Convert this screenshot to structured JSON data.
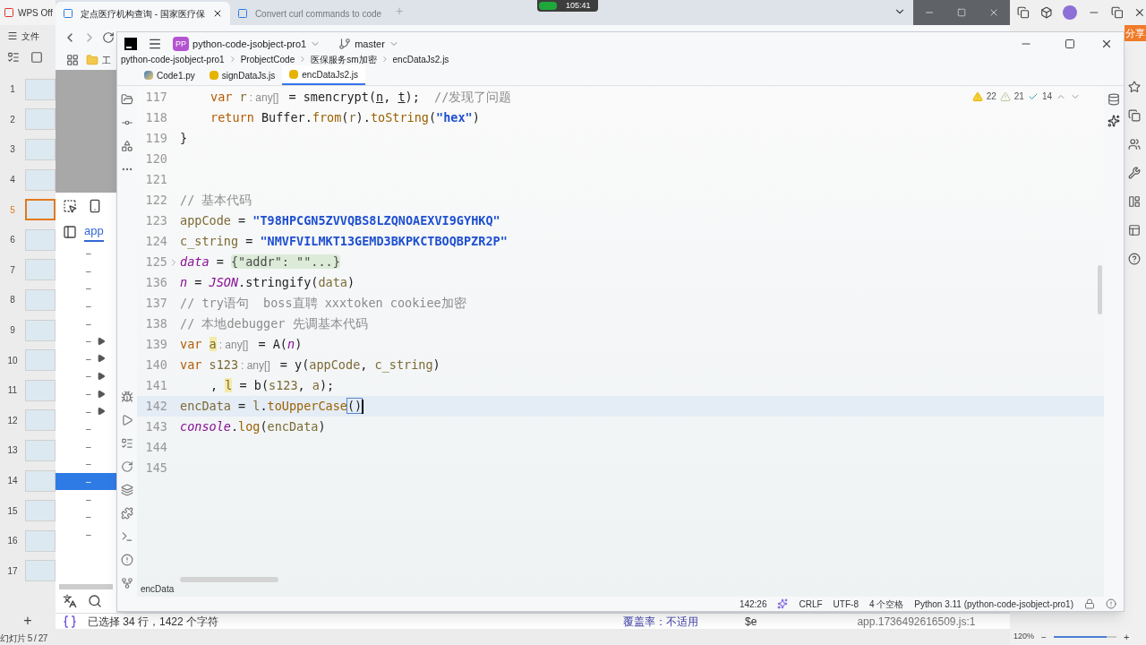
{
  "wps": {
    "tab": "WPS Off",
    "menu": "文件",
    "slides": [
      {
        "number": "1",
        "selected": false
      },
      {
        "number": "2",
        "selected": false
      },
      {
        "number": "3",
        "selected": false
      },
      {
        "number": "4",
        "selected": false
      },
      {
        "number": "5",
        "selected": true
      },
      {
        "number": "6",
        "selected": false
      },
      {
        "number": "7",
        "selected": false
      },
      {
        "number": "8",
        "selected": false
      },
      {
        "number": "9",
        "selected": false
      },
      {
        "number": "10",
        "selected": false
      },
      {
        "number": "11",
        "selected": false
      },
      {
        "number": "12",
        "selected": false
      },
      {
        "number": "13",
        "selected": false
      },
      {
        "number": "14",
        "selected": false
      },
      {
        "number": "15",
        "selected": false
      },
      {
        "number": "16",
        "selected": false
      },
      {
        "number": "17",
        "selected": false
      }
    ],
    "add": "+",
    "status": "幻灯片 5 / 27",
    "share": "分享",
    "zoom": "120%",
    "zoom_out": "−",
    "zoom_in": "+",
    "zoom_slider": {
      "level": 0.85
    }
  },
  "recorder": {
    "time": "105:41"
  },
  "browser": {
    "tabs": [
      {
        "title": "定点医疗机构查询 - 国家医疗保",
        "selected": true
      },
      {
        "title": "Convert curl commands to code",
        "selected": false
      }
    ],
    "new_tab": "+",
    "bookmark": "工",
    "devtools": {
      "tab": {
        "label": "app",
        "selected": true
      },
      "rows": [
        {
          "text": "–",
          "expandable": false,
          "selected": false
        },
        {
          "text": "–",
          "expandable": false,
          "selected": false
        },
        {
          "text": "–",
          "expandable": false,
          "selected": false
        },
        {
          "text": "–",
          "expandable": false,
          "selected": false
        },
        {
          "text": "–",
          "expandable": false,
          "selected": false
        },
        {
          "text": "–",
          "expandable": true,
          "selected": false
        },
        {
          "text": "–",
          "expandable": true,
          "selected": false
        },
        {
          "text": "–",
          "expandable": true,
          "selected": false
        },
        {
          "text": "–",
          "expandable": true,
          "selected": false
        },
        {
          "text": "–",
          "expandable": true,
          "selected": false
        },
        {
          "text": "–",
          "expandable": false,
          "selected": false
        },
        {
          "text": "–",
          "expandable": false,
          "selected": false
        },
        {
          "text": "–",
          "expandable": false,
          "selected": false
        },
        {
          "text": "–",
          "expandable": false,
          "selected": true
        },
        {
          "text": "–",
          "expandable": false,
          "selected": false
        },
        {
          "text": "–",
          "expandable": false,
          "selected": false
        },
        {
          "text": "–",
          "expandable": false,
          "selected": false
        }
      ],
      "selection": "已选择 34 行，1422 个字符",
      "coverage": "覆盖率：不适用",
      "variable": "$e",
      "source": "app.1736492616509.js:1"
    }
  },
  "ide": {
    "project_badge": "PP",
    "project": "python-code-jsobject-pro1",
    "branch": "master",
    "breadcrumbs": [
      "python-code-jsobject-pro1",
      "ProbjectCode",
      "医保服务sm加密",
      "encDataJs2.js"
    ],
    "tabs": [
      {
        "label": "Code1.py",
        "kind": "py",
        "selected": false
      },
      {
        "label": "signDataJs.js",
        "kind": "js",
        "selected": false
      },
      {
        "label": "encDataJs2.js",
        "kind": "js",
        "selected": true
      }
    ],
    "inspections": {
      "warnings": "22",
      "weak_warnings": "21",
      "typos": "14"
    },
    "lines": [
      {
        "number": "117",
        "indented": true,
        "foldable": false,
        "current": false,
        "tokens": [
          {
            "kind": "kw",
            "text": "var "
          },
          {
            "kind": "local",
            "text": "r"
          },
          {
            "kind": "hint",
            "text": ": any[]"
          },
          {
            "kind": "plain",
            "text": " = smencrypt("
          },
          {
            "kind": "param",
            "text": "n"
          },
          {
            "kind": "plain",
            "text": ", "
          },
          {
            "kind": "param",
            "text": "t"
          },
          {
            "kind": "plain",
            "text": ");  "
          },
          {
            "kind": "cmt",
            "text": "//发现了问题"
          }
        ]
      },
      {
        "number": "118",
        "indented": true,
        "foldable": false,
        "current": false,
        "tokens": [
          {
            "kind": "kw",
            "text": "return "
          },
          {
            "kind": "plain",
            "text": "Buffer."
          },
          {
            "kind": "fn",
            "text": "from"
          },
          {
            "kind": "plain",
            "text": "("
          },
          {
            "kind": "local",
            "text": "r"
          },
          {
            "kind": "plain",
            "text": ")."
          },
          {
            "kind": "fn",
            "text": "toString"
          },
          {
            "kind": "plain",
            "text": "("
          },
          {
            "kind": "str",
            "text": "\"hex\""
          },
          {
            "kind": "plain",
            "text": ")"
          }
        ]
      },
      {
        "number": "119",
        "indented": false,
        "foldable": false,
        "current": false,
        "tokens": [
          {
            "kind": "plain",
            "text": "}"
          }
        ]
      },
      {
        "number": "120",
        "foldable": false,
        "current": false
      },
      {
        "number": "121",
        "foldable": false,
        "current": false
      },
      {
        "number": "122",
        "indented": false,
        "foldable": false,
        "current": false,
        "tokens": [
          {
            "kind": "cmt",
            "text": "// 基本代码"
          }
        ]
      },
      {
        "number": "123",
        "indented": false,
        "foldable": false,
        "current": false,
        "tokens": [
          {
            "kind": "local",
            "text": "appCode"
          },
          {
            "kind": "plain",
            "text": " = "
          },
          {
            "kind": "str",
            "text": "\"T98HPCGN5ZVVQBS8LZQNOAEXVI9GYHKQ\""
          }
        ]
      },
      {
        "number": "124",
        "indented": false,
        "foldable": false,
        "current": false,
        "tokens": [
          {
            "kind": "local",
            "text": "c_string"
          },
          {
            "kind": "plain",
            "text": " = "
          },
          {
            "kind": "str",
            "text": "\"NMVFVILMKT13GEMD3BKPKCTBOQBPZR2P\""
          }
        ]
      },
      {
        "number": "125",
        "indented": false,
        "foldable": true,
        "current": false,
        "tokens": [
          {
            "kind": "global",
            "text": "data"
          },
          {
            "kind": "plain",
            "text": " = "
          },
          {
            "kind": "fold",
            "text": "{\"addr\": \"\"...}"
          }
        ]
      },
      {
        "number": "136",
        "indented": false,
        "foldable": false,
        "current": false,
        "tokens": [
          {
            "kind": "global",
            "text": "n"
          },
          {
            "kind": "plain",
            "text": " = "
          },
          {
            "kind": "global",
            "text": "JSON"
          },
          {
            "kind": "plain",
            "text": ".stringify("
          },
          {
            "kind": "local",
            "text": "data"
          },
          {
            "kind": "plain",
            "text": ")"
          }
        ]
      },
      {
        "number": "137",
        "indented": false,
        "foldable": false,
        "current": false,
        "tokens": [
          {
            "kind": "cmt",
            "text": "// try语句  boss直聘 xxxtoken cookiee加密"
          }
        ]
      },
      {
        "number": "138",
        "indented": false,
        "foldable": false,
        "current": false,
        "tokens": [
          {
            "kind": "cmt",
            "text": "// 本地debugger 先调基本代码"
          }
        ]
      },
      {
        "number": "139",
        "indented": false,
        "foldable": false,
        "current": false,
        "tokens": [
          {
            "kind": "kw",
            "text": "var "
          },
          {
            "kind": "mark",
            "text": "a"
          },
          {
            "kind": "hint",
            "text": ": any[]"
          },
          {
            "kind": "plain",
            "text": " = A("
          },
          {
            "kind": "global",
            "text": "n"
          },
          {
            "kind": "plain",
            "text": ")"
          }
        ]
      },
      {
        "number": "140",
        "indented": false,
        "foldable": false,
        "current": false,
        "tokens": [
          {
            "kind": "kw",
            "text": "var "
          },
          {
            "kind": "local",
            "text": "s123"
          },
          {
            "kind": "hint",
            "text": ": any[]"
          },
          {
            "kind": "plain",
            "text": " = y("
          },
          {
            "kind": "local",
            "text": "appCode"
          },
          {
            "kind": "plain",
            "text": ", "
          },
          {
            "kind": "local",
            "text": "c_string"
          },
          {
            "kind": "plain",
            "text": ")"
          }
        ]
      },
      {
        "number": "141",
        "indented": true,
        "foldable": false,
        "current": false,
        "tokens": [
          {
            "kind": "plain",
            "text": ", "
          },
          {
            "kind": "mark",
            "text": "l"
          },
          {
            "kind": "plain",
            "text": " = b("
          },
          {
            "kind": "local",
            "text": "s123"
          },
          {
            "kind": "plain",
            "text": ", "
          },
          {
            "kind": "local",
            "text": "a"
          },
          {
            "kind": "plain",
            "text": ");"
          }
        ]
      },
      {
        "number": "142",
        "indented": false,
        "foldable": false,
        "current": true,
        "tokens": [
          {
            "kind": "local",
            "text": "encData"
          },
          {
            "kind": "plain",
            "text": " = "
          },
          {
            "kind": "local",
            "text": "l"
          },
          {
            "kind": "plain",
            "text": "."
          },
          {
            "kind": "fn",
            "text": "toUpperCase"
          },
          {
            "kind": "match",
            "text": "()"
          }
        ]
      },
      {
        "number": "143",
        "indented": false,
        "foldable": false,
        "current": false,
        "tokens": [
          {
            "kind": "global",
            "text": "console"
          },
          {
            "kind": "plain",
            "text": "."
          },
          {
            "kind": "fn",
            "text": "log"
          },
          {
            "kind": "plain",
            "text": "("
          },
          {
            "kind": "local",
            "text": "encData"
          },
          {
            "kind": "plain",
            "text": ")"
          }
        ]
      },
      {
        "number": "144",
        "foldable": false,
        "current": false
      },
      {
        "number": "145",
        "foldable": false,
        "current": false
      }
    ],
    "code_breadcrumb": "encData",
    "status": {
      "position": "142:26",
      "line_ending": "CRLF",
      "encoding": "UTF-8",
      "indent": "4 个空格",
      "interpreter": "Python 3.11 (python-code-jsobject-pro1)"
    }
  }
}
